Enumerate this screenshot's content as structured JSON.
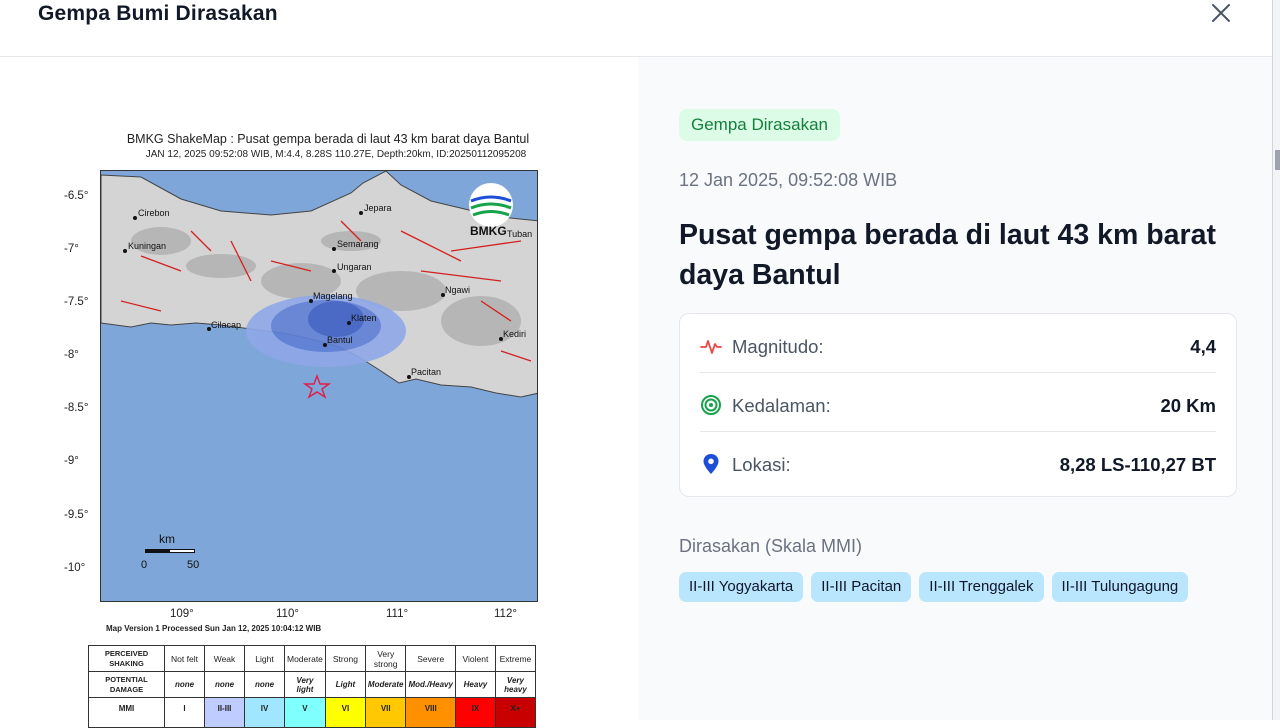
{
  "modal": {
    "title": "Gempa Bumi Dirasakan",
    "close_icon": "close-icon"
  },
  "shakemap": {
    "title": "BMKG ShakeMap : Pusat gempa berada di laut 43 km barat daya Bantul",
    "subtitle": "JAN 12, 2025 09:52:08 WIB, M:4.4, 8.28S 110.27E, Depth:20km, ID:20250112095208",
    "y_ticks": [
      "-6.5°",
      "-7°",
      "-7.5°",
      "-8°",
      "-8.5°",
      "-9°",
      "-9.5°",
      "-10°"
    ],
    "x_ticks": [
      "109°",
      "110°",
      "111°",
      "112°"
    ],
    "cities": [
      "Cirebon",
      "Kuningan",
      "Jepara",
      "Semarang",
      "Ungaran",
      "Magelang",
      "Klaten",
      "Bantul",
      "Cilacap",
      "Pacitan",
      "Ngawi",
      "Kediri",
      "Tuban"
    ],
    "logo_text": "BMKG",
    "scale_unit": "km",
    "scale_start": "0",
    "scale_end": "50",
    "version": "Map Version 1 Processed Sun Jan 12, 2025 10:04:12 WIB",
    "legend": {
      "row1_header": "PERCEIVED SHAKING",
      "row2_header": "POTENTIAL DAMAGE",
      "row3_header": "MMI",
      "shaking": [
        "Not felt",
        "Weak",
        "Light",
        "Moderate",
        "Strong",
        "Very strong",
        "Severe",
        "Violent",
        "Extreme"
      ],
      "damage": [
        "none",
        "none",
        "none",
        "Very light",
        "Light",
        "Moderate",
        "Mod./Heavy",
        "Heavy",
        "Very heavy"
      ],
      "mmi": [
        "I",
        "II-III",
        "IV",
        "V",
        "VI",
        "VII",
        "VIII",
        "IX",
        "X+"
      ],
      "mmi_colors": [
        "#ffffff",
        "#bfccff",
        "#a0e6ff",
        "#80ffff",
        "#ffff00",
        "#ffc800",
        "#ff9100",
        "#ff0000",
        "#c80000"
      ]
    }
  },
  "detail": {
    "badge": "Gempa Dirasakan",
    "datetime": "12 Jan 2025, 09:52:08 WIB",
    "headline": "Pusat gempa berada di laut 43 km barat daya Bantul",
    "rows": [
      {
        "icon": "pulse-icon",
        "label": "Magnitudo:",
        "value": "4,4"
      },
      {
        "icon": "target-icon",
        "label": "Kedalaman:",
        "value": "20 Km"
      },
      {
        "icon": "map-pin-icon",
        "label": "Lokasi:",
        "value": "8,28 LS-110,27 BT"
      }
    ],
    "felt_title": "Dirasakan (Skala MMI)",
    "felt_areas": [
      "II-III Yogyakarta",
      "II-III Pacitan",
      "II-III Trenggalek",
      "II-III Tulungagung"
    ]
  },
  "colors": {
    "badge_bg": "#dcfce7",
    "badge_text": "#15803d",
    "chip_bg": "#bae6fd",
    "pulse_icon": "#ef4444",
    "target_icon": "#16a34a",
    "pin_icon": "#1d4ed8",
    "epicenter_star": "#e11d48"
  }
}
